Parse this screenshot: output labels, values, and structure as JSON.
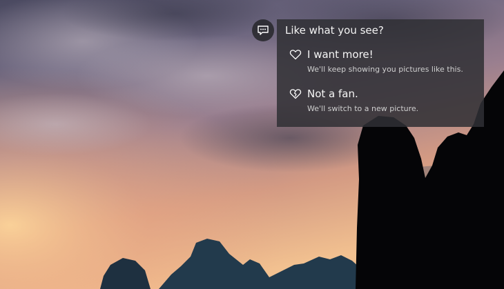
{
  "background": {
    "icon": "lock-screen-landscape"
  },
  "feedback": {
    "button_icon": "chat-bubble-icon",
    "title": "Like what you see?",
    "options": [
      {
        "icon": "heart-outline-icon",
        "label": "I want more!",
        "description": "We'll keep showing you pictures like this."
      },
      {
        "icon": "broken-heart-icon",
        "label": "Not a fan.",
        "description": "We'll switch to a new picture."
      }
    ]
  }
}
